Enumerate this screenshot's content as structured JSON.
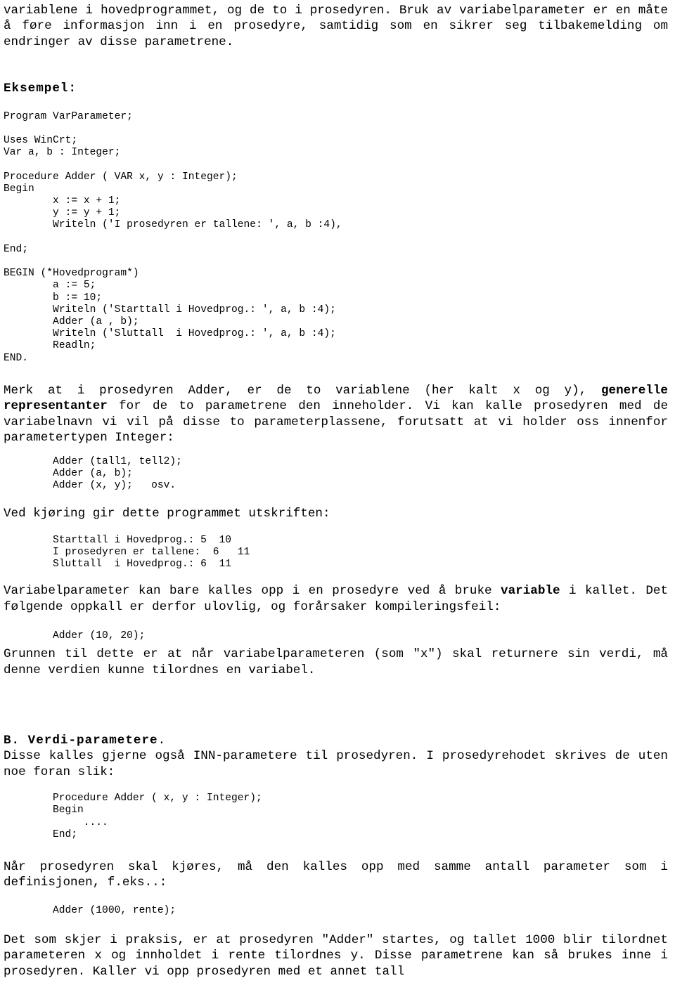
{
  "document": {
    "language": "Norwegian",
    "intro_paragraph": {
      "lines": [
        "variablene i hovedprogrammet, og de to i prosedyren. Bruk av variabelparameter",
        "er en måte å føre informasjon inn i en prosedyre, samtidig som en sikrer seg",
        "tilbakemelding om endringer av disse parametrene."
      ],
      "text": "variablene i hovedprogrammet, og de to i prosedyren. Bruk av variabelparameter er en måte å føre informasjon inn i en prosedyre, samtidig som en sikrer seg tilbakemelding om endringer av disse parametrene."
    },
    "example_heading": "Eksempel:",
    "example_code": "Program VarParameter;\n\nUses WinCrt;\nVar a, b : Integer;\n\nProcedure Adder ( VAR x, y : Integer);\nBegin\n        x := x + 1;\n        y := y + 1;\n        Writeln ('I prosedyren er tallene: ', a, b :4),\n\nEnd;\n\nBEGIN (*Hovedprogram*)\n        a := 5;\n        b := 10;\n        Writeln ('Starttall i Hovedprog.: ', a, b :4);\n        Adder (a , b);\n        Writeln ('Sluttall  i Hovedprog.: ', a, b :4);\n        Readln;\nEND.",
    "merk_paragraph": {
      "part1": "Merk at i prosedyren Adder, er de to variablene (her kalt x og y), ",
      "bold1": "generelle representanter",
      "part2": " for de to parametrene den inneholder. Vi kan kalle prosedyren med de variabelnavn vi vil på disse to parameterplassene, forutsatt at vi holder oss innenfor parametertypen Integer:"
    },
    "adder_calls_code": "Adder (tall1, tell2);\nAdder (a, b);\nAdder (x, y);   osv.",
    "run_intro": "Ved kjøring gir dette programmet utskriften:",
    "program_output": "Starttall i Hovedprog.: 5  10\nI prosedyren er tallene:  6   11\nSluttall  i Hovedprog.: 6  11",
    "variabelparameter_paragraph": {
      "part1": "Variabelparameter kan bare kalles opp i en prosedyre ved å bruke ",
      "bold1": "variable",
      "part2": " i kallet. Det følgende oppkall er derfor ulovlig, og forårsaker kompileringsfeil:"
    },
    "illegal_call_code": "Adder (10, 20);",
    "grunnen_paragraph": "Grunnen til dette er at når variabelparameteren (som \"x\") skal returnere sin verdi, må denne verdien kunne tilordnes en variabel.",
    "section_b": {
      "heading_bold": "B. Verdi-parametere",
      "heading_tail": ".",
      "body": "Disse kalles gjerne også INN-parametere til prosedyren. I prosedyrehodet skrives de uten noe foran slik:"
    },
    "value_param_code": "Procedure Adder ( x, y : Integer);\nBegin\n     ....\nEnd;",
    "naar_paragraph": "Når prosedyren skal kjøres, må den kalles opp med samme antall parameter som i definisjonen, f.eks..:",
    "rente_call_code": "Adder (1000, rente);",
    "closing_paragraph": "Det som skjer i praksis, er at prosedyren \"Adder\"  startes, og tallet 1000 blir tilordnet parameteren x og innholdet i rente tilordnes y. Disse parametrene kan så brukes inne i prosedyren. Kaller vi opp prosedyren med et annet tall"
  }
}
